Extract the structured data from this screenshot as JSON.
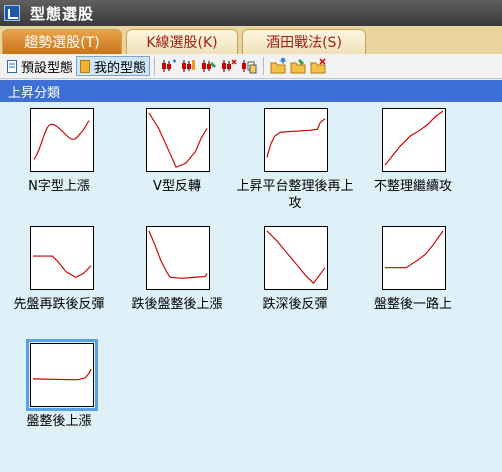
{
  "window": {
    "title": "型態選股"
  },
  "tabs": [
    {
      "label": "趨勢選股(T)"
    },
    {
      "label": "K線選股(K)"
    },
    {
      "label": "酒田戰法(S)"
    }
  ],
  "toolbar": {
    "preset_label": "預設型態",
    "mine_label": "我的型態"
  },
  "section": {
    "title": "上昇分類"
  },
  "patterns": [
    {
      "label": "N字型上漲"
    },
    {
      "label": "V型反轉"
    },
    {
      "label": "上昇平台整理後再上攻"
    },
    {
      "label": "不整理繼續攻"
    },
    {
      "label": "先盤再跌後反彈"
    },
    {
      "label": "跌後盤整後上漲"
    },
    {
      "label": "跌深後反彈"
    },
    {
      "label": "盤整後一路上"
    },
    {
      "label": "盤整後上漲"
    }
  ],
  "colors": {
    "curve": "#cc0000",
    "header": "#3d6fd6",
    "background": "#dff1f8"
  }
}
